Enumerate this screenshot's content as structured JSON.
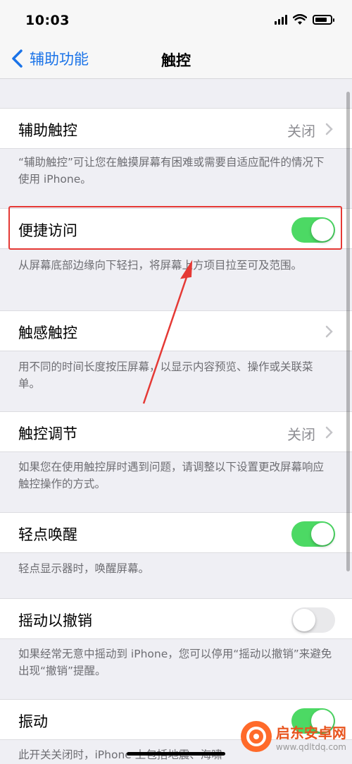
{
  "status_bar": {
    "time": "10:03"
  },
  "nav": {
    "back_label": "辅助功能",
    "title": "触控"
  },
  "rows": [
    {
      "label": "辅助触控",
      "value": "关闭",
      "footer": "“辅助触控”可让您在触摸屏幕有困难或需要自适应配件的情况下使用 iPhone。"
    },
    {
      "label": "便捷访问",
      "toggle_on": true,
      "footer": "从屏幕底部边缘向下轻扫，将屏幕上方项目拉至可及范围。"
    },
    {
      "label": "触感触控",
      "footer": "用不同的时间长度按压屏幕，以显示内容预览、操作或关联菜单。"
    },
    {
      "label": "触控调节",
      "value": "关闭",
      "footer": "如果您在使用触控屏时遇到问题，请调整以下设置更改屏幕响应触控操作的方式。"
    },
    {
      "label": "轻点唤醒",
      "toggle_on": true,
      "footer": "轻点显示器时，唤醒屏幕。"
    },
    {
      "label": "摇动以撤销",
      "toggle_on": false,
      "footer": "如果经常无意中摇动到 iPhone，您可以停用“摇动以撤销”来避免出现“撤销”提醒。"
    },
    {
      "label": "振动",
      "toggle_on": true,
      "footer": "此开关关闭时，iPhone 上包括地震、海啸"
    }
  ],
  "watermark": {
    "title": "启东安卓网",
    "url": "www.qdltdq.com"
  },
  "colors": {
    "accent": "#1a73e8",
    "toggle_on": "#4cd964",
    "toggle_off": "#e9e9eb",
    "highlight": "#e53935"
  }
}
